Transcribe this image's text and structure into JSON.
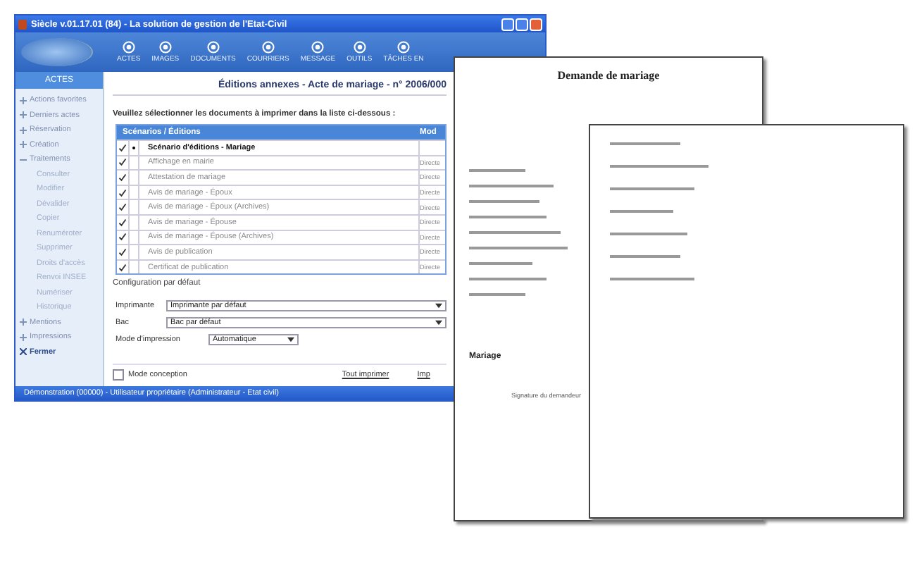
{
  "window": {
    "title": "Siècle v.01.17.01 (84) - La solution de gestion de l'Etat-Civil"
  },
  "toolbar": [
    "ACTES",
    "IMAGES",
    "DOCUMENTS",
    "COURRIERS",
    "MESSAGE",
    "OUTILS",
    "TÂCHES EN"
  ],
  "sidebar": {
    "header": "ACTES",
    "items": [
      {
        "label": "Actions favorites",
        "kind": "group",
        "expanded": false
      },
      {
        "label": "Derniers actes",
        "kind": "group",
        "expanded": false
      },
      {
        "label": "Réservation",
        "kind": "group",
        "expanded": false
      },
      {
        "label": "Création",
        "kind": "group",
        "expanded": false
      },
      {
        "label": "Traitements",
        "kind": "group",
        "expanded": true,
        "children": [
          "Consulter",
          "Modifier",
          "Dévalider",
          "Copier",
          "Renuméroter",
          "Supprimer",
          "Droits d'accès",
          "Renvoi INSEE",
          "Numériser",
          "Historique"
        ]
      },
      {
        "label": "Mentions",
        "kind": "group",
        "expanded": false
      },
      {
        "label": "Impressions",
        "kind": "group",
        "expanded": false
      },
      {
        "label": "Fermer",
        "kind": "close"
      }
    ]
  },
  "content": {
    "heading": "Éditions annexes - Acte de mariage - n° 2006/000",
    "instruction": "Veuillez sélectionner les documents à imprimer dans la liste ci-dessous :",
    "table": {
      "columns": [
        "Scénarios / Éditions",
        "Mod"
      ],
      "rows": [
        {
          "label": "Scénario d'éditions - Mariage",
          "kind": "group",
          "checked": true
        },
        {
          "label": "Affichage en mairie",
          "kind": "item",
          "checked": true,
          "mode": "Directe"
        },
        {
          "label": "Attestation de mariage",
          "kind": "item",
          "checked": true,
          "mode": "Directe"
        },
        {
          "label": "Avis de mariage - Époux",
          "kind": "item",
          "checked": true,
          "mode": "Directe"
        },
        {
          "label": "Avis de mariage - Époux (Archives)",
          "kind": "item",
          "checked": true,
          "mode": "Directe"
        },
        {
          "label": "Avis de mariage - Épouse",
          "kind": "item",
          "checked": true,
          "mode": "Directe"
        },
        {
          "label": "Avis de mariage - Épouse (Archives)",
          "kind": "item",
          "checked": true,
          "mode": "Directe"
        },
        {
          "label": "Avis de publication",
          "kind": "item",
          "checked": true,
          "mode": "Directe"
        },
        {
          "label": "Certificat de publication",
          "kind": "item",
          "checked": true,
          "mode": "Directe"
        }
      ]
    },
    "config": {
      "title": "Configuration par défaut",
      "fields": [
        {
          "label": "Imprimante",
          "value": "Imprimante par défaut",
          "kind": "wide"
        },
        {
          "label": "Bac",
          "value": "Bac par défaut",
          "kind": "wide"
        },
        {
          "label": "Mode d'impression",
          "value": "Automatique",
          "kind": "short"
        }
      ]
    },
    "mode_conception": {
      "label": "Mode conception",
      "checked": false
    },
    "buttons": [
      "Tout imprimer",
      "Imp"
    ]
  },
  "status_bar": "Démonstration (00000) - Utilisateur propriétaire (Administrateur - Etat civil)",
  "documents": [
    {
      "title": "Demande de mariage",
      "section": "Mariage",
      "signature": "Signature du demandeur"
    }
  ]
}
